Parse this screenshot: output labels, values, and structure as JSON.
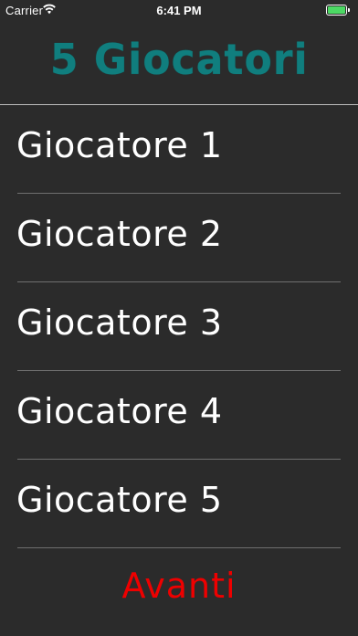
{
  "status_bar": {
    "carrier": "Carrier",
    "time": "6:41 PM",
    "wifi_icon": "wifi-icon",
    "battery_icon": "battery-icon",
    "battery_color": "#4cd964"
  },
  "header": {
    "title": "5 Giocatori",
    "title_color": "#107e7e"
  },
  "players": [
    {
      "label": "Giocatore 1"
    },
    {
      "label": "Giocatore 2"
    },
    {
      "label": "Giocatore 3"
    },
    {
      "label": "Giocatore 4"
    },
    {
      "label": "Giocatore 5"
    }
  ],
  "footer": {
    "next_label": "Avanti",
    "next_color": "#ee0000"
  },
  "theme": {
    "background": "#2b2b2b",
    "row_text": "#ffffff",
    "divider": "#6f6f6f"
  }
}
